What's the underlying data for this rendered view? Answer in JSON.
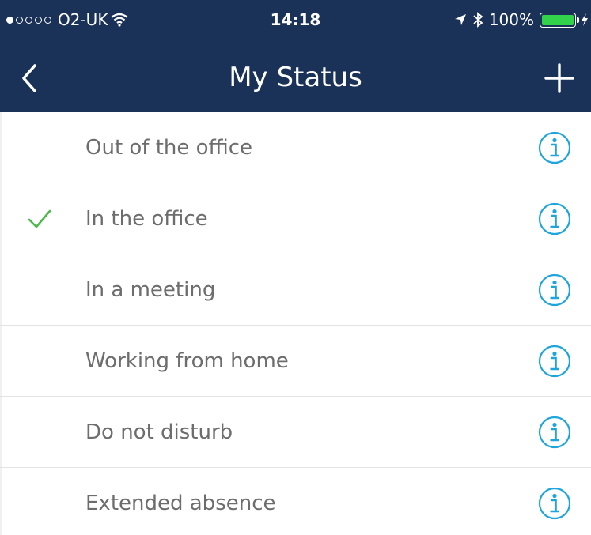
{
  "status_bar": {
    "carrier": "O2-UK",
    "time": "14:18",
    "battery": "100%",
    "signal_strength": 1,
    "battery_level": 1.0,
    "battery_color": "#32d34a"
  },
  "nav": {
    "title": "My Status",
    "back_icon": "chevron-left-icon",
    "add_icon": "plus-icon"
  },
  "colors": {
    "header_bg": "#1b3258",
    "info_icon": "#1ea5dc",
    "check_icon": "#4cb84c",
    "label_text": "#6d6d6d"
  },
  "statuses": [
    {
      "label": "Out of the office",
      "selected": false
    },
    {
      "label": "In the office",
      "selected": true
    },
    {
      "label": "In a meeting",
      "selected": false
    },
    {
      "label": "Working from home",
      "selected": false
    },
    {
      "label": "Do not disturb",
      "selected": false
    },
    {
      "label": "Extended absence",
      "selected": false
    }
  ]
}
